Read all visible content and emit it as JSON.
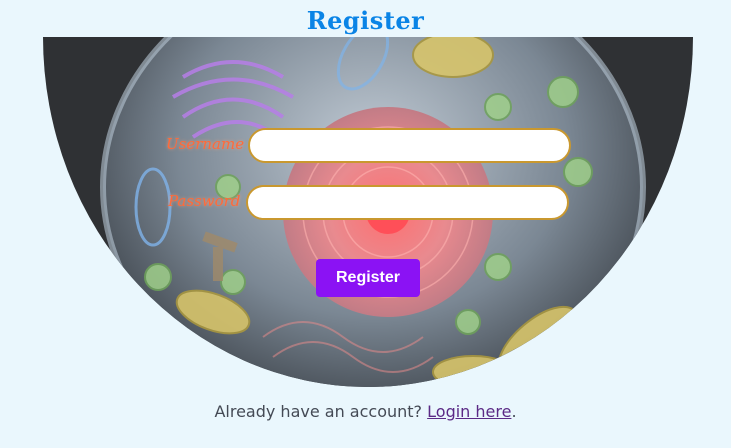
{
  "header": {
    "title": "Register"
  },
  "form": {
    "username_label": "Username",
    "password_label": "Password",
    "username_value": "",
    "password_value": "",
    "submit_label": "Register"
  },
  "footer": {
    "prompt": "Already have an account?",
    "link_label": "Login here",
    "suffix": "."
  },
  "colors": {
    "background": "#eaf7fd",
    "title": "#0a84e6",
    "button": "#8b12f4",
    "label": "#ff6a3a",
    "field_border": "#c9982f"
  }
}
